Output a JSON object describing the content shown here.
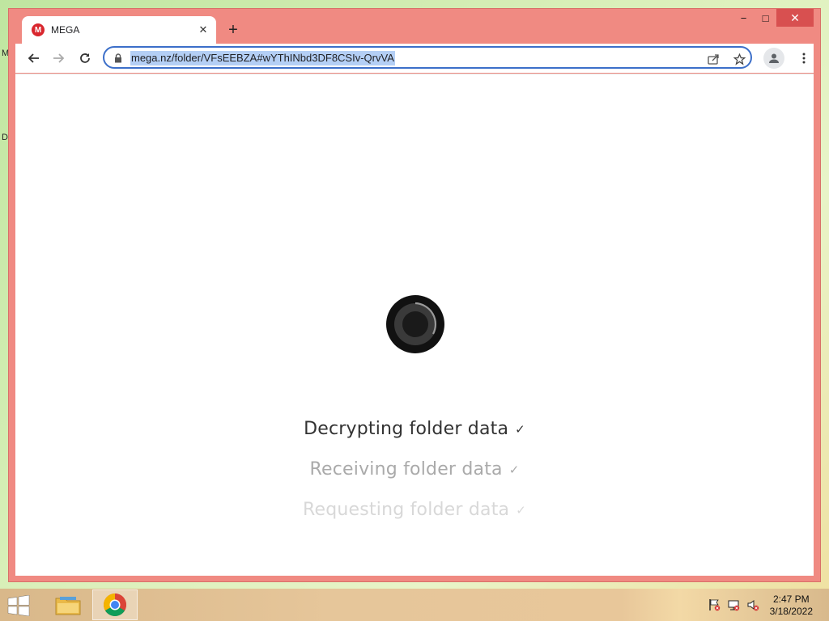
{
  "desktop": {
    "letter_top": "M",
    "letter_mid": "D"
  },
  "window": {
    "minimize": "−",
    "maximize": "□",
    "close": "✕"
  },
  "tab": {
    "favicon_letter": "M",
    "title": "MEGA",
    "close": "✕",
    "new_tab": "+"
  },
  "toolbar": {
    "url": "mega.nz/folder/VFsEEBZA#wYThINbd3DF8CSIv-QrvVA"
  },
  "page": {
    "steps": [
      {
        "label": "Decrypting folder data",
        "check": "✓"
      },
      {
        "label": "Receiving folder data",
        "check": "✓"
      },
      {
        "label": "Requesting folder data",
        "check": "✓"
      }
    ]
  },
  "taskbar": {
    "time": "2:47 PM",
    "date": "3/18/2022"
  },
  "colors": {
    "window_frame": "#f08a82",
    "omnibox_border": "#3c6fc9",
    "url_highlight": "#b4cff5",
    "mega_red": "#d9272e"
  }
}
